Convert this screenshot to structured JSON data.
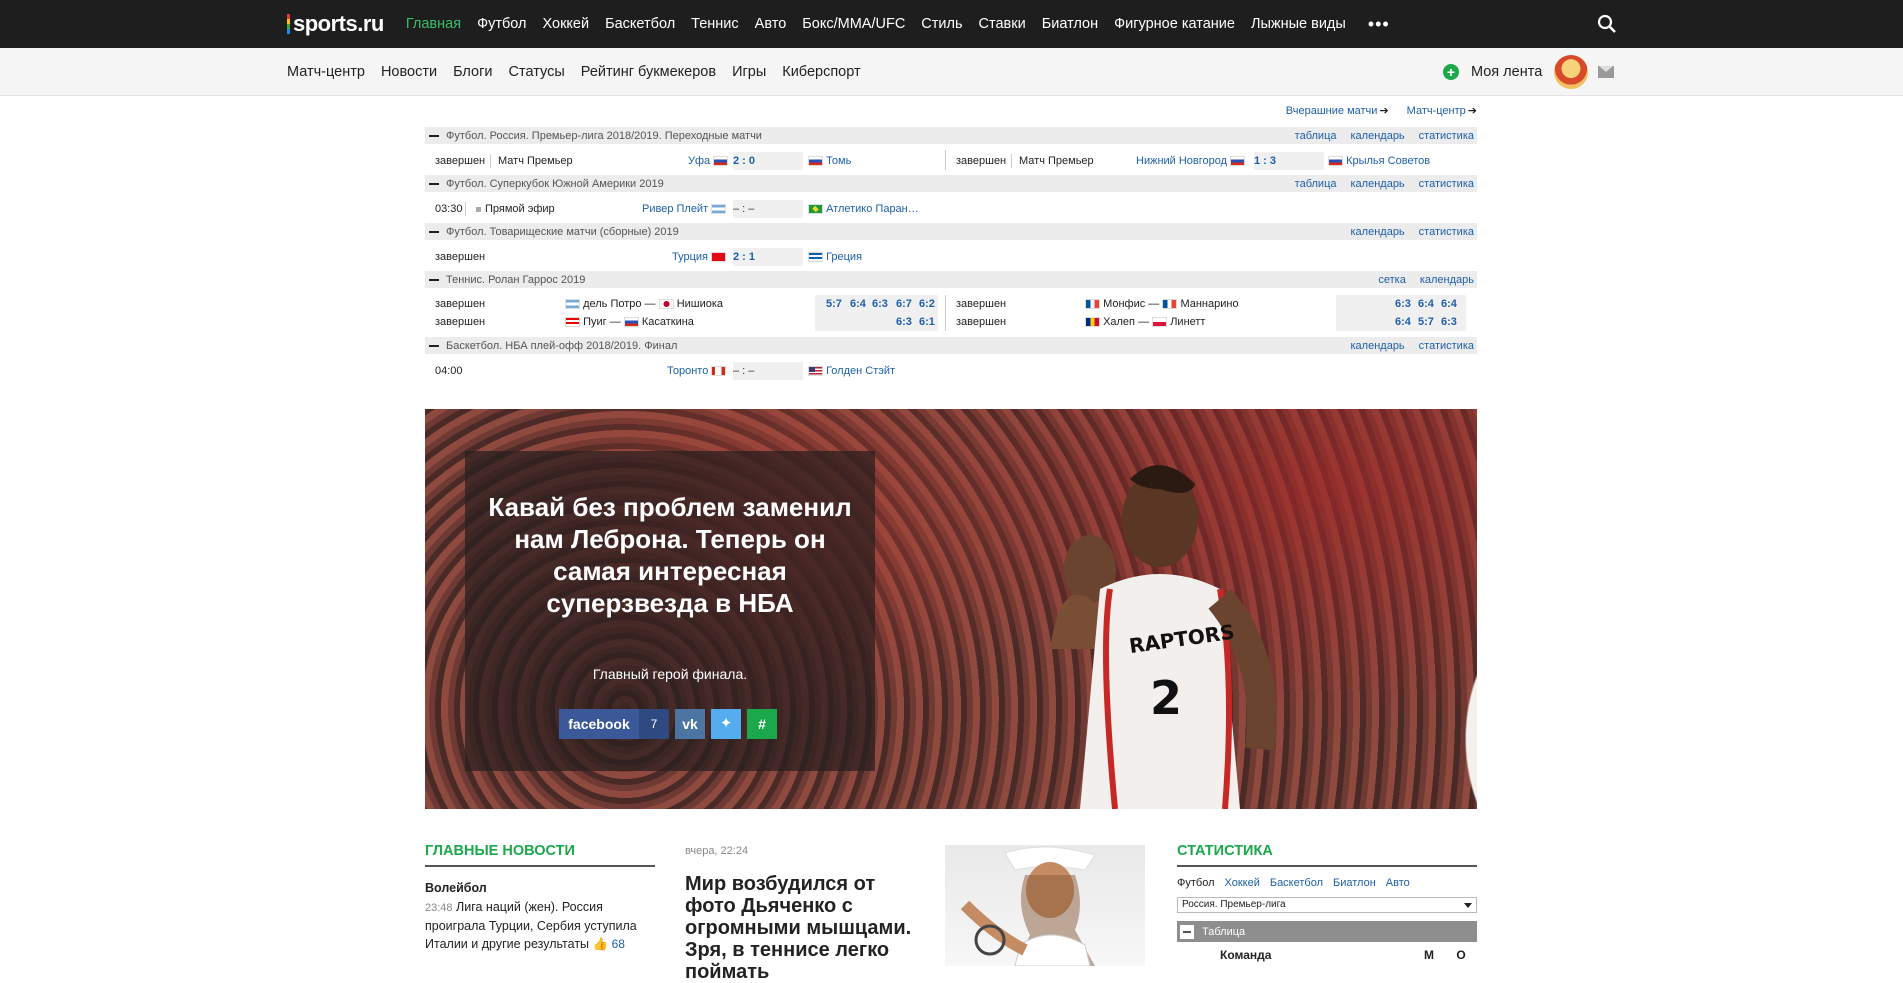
{
  "header": {
    "logo": "sports.ru",
    "nav": [
      "Главная",
      "Футбол",
      "Хоккей",
      "Баскетбол",
      "Теннис",
      "Авто",
      "Бокс/ММА/UFC",
      "Стиль",
      "Ставки",
      "Биатлон",
      "Фигурное катание",
      "Лыжные виды"
    ],
    "active_index": 0,
    "more": "•••"
  },
  "subnav": {
    "items": [
      "Матч-центр",
      "Новости",
      "Блоги",
      "Статусы",
      "Рейтинг букмекеров",
      "Игры",
      "Киберспорт"
    ],
    "feed_label": "Моя лента"
  },
  "scores": {
    "links": [
      "Вчерашние матчи",
      "Матч-центр"
    ],
    "tournaments": [
      {
        "name": "Футбол. Россия. Премьер-лига 2018/2019. Переходные матчи",
        "links": [
          "таблица",
          "календарь",
          "статистика"
        ],
        "matches": [
          {
            "status": "завершен",
            "stage": "Матч Премьер",
            "home": "Уфа",
            "score": "2 : 0",
            "away": "Томь"
          },
          {
            "status": "завершен",
            "stage": "Матч Премьер",
            "home": "Нижний Новгород",
            "score": "1 : 3",
            "away": "Крылья Советов"
          }
        ]
      },
      {
        "name": "Футбол. Суперкубок Южной Америки 2019",
        "links": [
          "таблица",
          "календарь",
          "статистика"
        ],
        "matches": [
          {
            "status": "03:30",
            "stage": "Прямой эфир",
            "home": "Ривер Плейт",
            "score": "– : –",
            "away": "Атлетико Паран…"
          }
        ]
      },
      {
        "name": "Футбол. Товарищеские матчи (сборные) 2019",
        "links": [
          "календарь",
          "статистика"
        ],
        "matches": [
          {
            "status": "завершен",
            "home": "Турция",
            "score": "2 : 1",
            "away": "Греция"
          }
        ]
      },
      {
        "name": "Теннис. Ролан Гаррос 2019",
        "links": [
          "сетка",
          "календарь"
        ],
        "matches": [
          {
            "status": "завершен",
            "p1": "дель Потро",
            "p2": "Нишиока",
            "sets": [
              "5:7",
              "6:4",
              "6:3",
              "6:7",
              "6:2"
            ]
          },
          {
            "status": "завершен",
            "p1": "Пуиг",
            "p2": "Касаткина",
            "sets": [
              "6:3",
              "6:1"
            ]
          },
          {
            "status": "завершен",
            "p1": "Монфис",
            "p2": "Маннарино",
            "sets": [
              "6:3",
              "6:4",
              "6:4"
            ]
          },
          {
            "status": "завершен",
            "p1": "Халеп",
            "p2": "Линетт",
            "sets": [
              "6:4",
              "5:7",
              "6:3"
            ]
          }
        ]
      },
      {
        "name": "Баскетбол. НБА плей-офф 2018/2019. Финал",
        "links": [
          "календарь",
          "статистика"
        ],
        "matches": [
          {
            "status": "04:00",
            "home": "Торонто",
            "score": "– : –",
            "away": "Голден Стэйт"
          }
        ]
      }
    ]
  },
  "hero": {
    "title": "Кавай без проблем заменил нам Леброна. Теперь он самая интересная суперзвезда в НБА",
    "subtitle": "Главный герой финала.",
    "facebook_label": "facebook",
    "facebook_count": "7",
    "jersey_text": "RAPTORS",
    "jersey_number": "2"
  },
  "news": {
    "heading": "ГЛАВНЫЕ НОВОСТИ",
    "category": "Волейбол",
    "time": "23:48",
    "text": "Лига наций (жен). Россия проиграла Турции, Сербия уступила Италии и другие результаты",
    "likes": "68"
  },
  "feature": {
    "date": "вчера, 22:24",
    "title": "Мир возбудился от фото Дьяченко с огромными мышцами. Зря, в теннисе легко поймать"
  },
  "stats": {
    "heading": "СТАТИСТИКА",
    "tabs": [
      "Футбол",
      "Хоккей",
      "Баскетбол",
      "Биатлон",
      "Авто"
    ],
    "league": "Россия. Премьер-лига",
    "table_label": "Таблица",
    "col_team": "Команда",
    "col_m": "М",
    "col_o": "О"
  },
  "colors": {
    "accent": "#37c06a",
    "link": "#1e5fa8",
    "topbar": "#1e1e1e",
    "facebook": "#3b5998",
    "vk": "#4c75a3",
    "twitter": "#55acee",
    "hash": "#1aa84a"
  }
}
